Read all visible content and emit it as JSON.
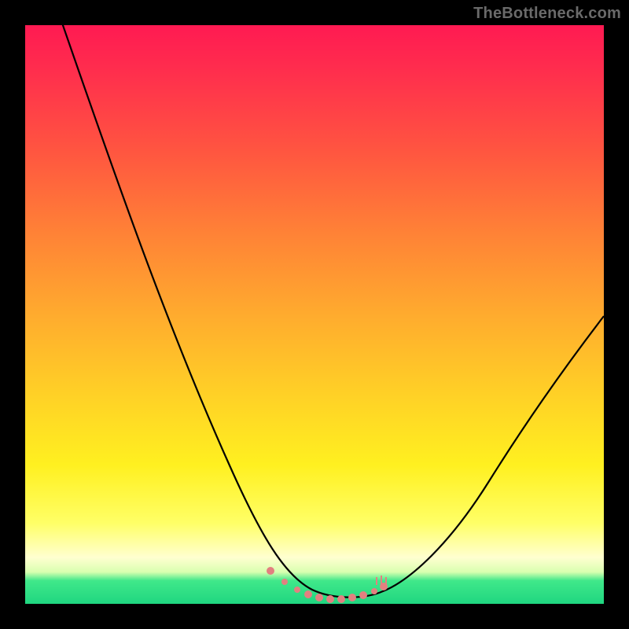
{
  "watermark": {
    "text": "TheBottleneck.com"
  },
  "chart_data": {
    "type": "line",
    "title": "",
    "xlabel": "",
    "ylabel": "",
    "xlim": [
      0,
      100
    ],
    "ylim": [
      0,
      100
    ],
    "grid": false,
    "legend": null,
    "series": [
      {
        "name": "bottleneck-curve",
        "x": [
          0,
          5,
          10,
          15,
          20,
          25,
          30,
          35,
          40,
          42,
          45,
          48,
          50,
          55,
          58,
          62,
          70,
          80,
          90,
          100
        ],
        "y": [
          108,
          95,
          82,
          70,
          58,
          46,
          34,
          22,
          10,
          6,
          3,
          1,
          0,
          0,
          1,
          4,
          12,
          24,
          37,
          50
        ]
      }
    ],
    "flat_region": {
      "x_start": 40,
      "x_end": 60,
      "marker_color": "#e07a7a",
      "note": "pink dotted/bead markers along curve minimum"
    },
    "background_gradient": {
      "top": "#ff1a52",
      "mid": "#ffd126",
      "bottom": "#1fd680"
    }
  }
}
